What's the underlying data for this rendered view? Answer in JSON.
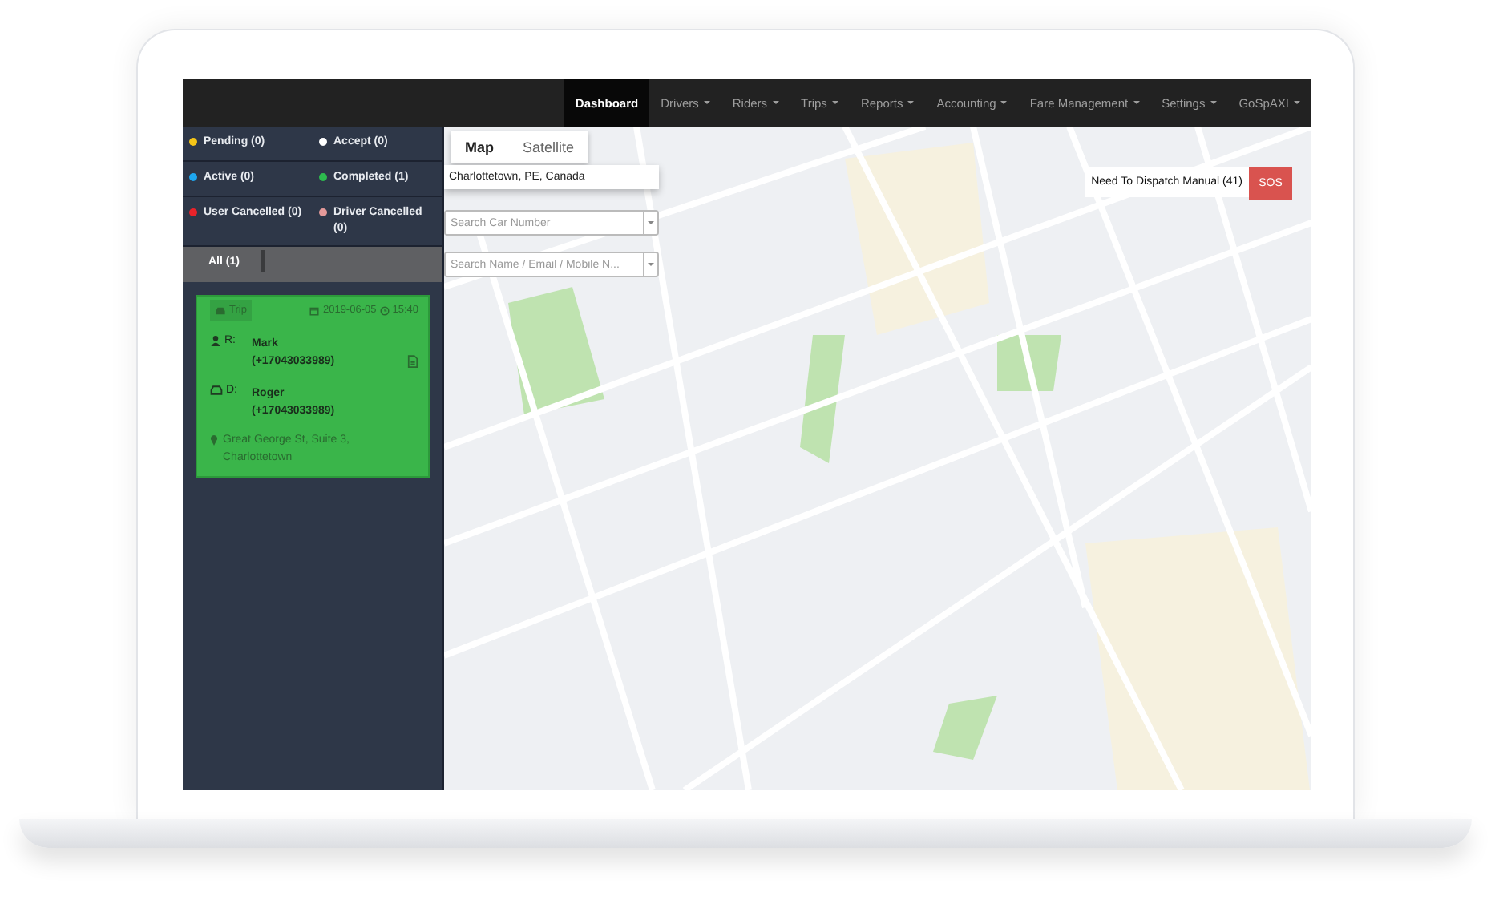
{
  "nav": {
    "items": [
      {
        "label": "Dashboard",
        "selected": true,
        "dropdown": false
      },
      {
        "label": "Drivers",
        "selected": false,
        "dropdown": true
      },
      {
        "label": "Riders",
        "selected": false,
        "dropdown": true
      },
      {
        "label": "Trips",
        "selected": false,
        "dropdown": true
      },
      {
        "label": "Reports",
        "selected": false,
        "dropdown": true
      },
      {
        "label": "Accounting",
        "selected": false,
        "dropdown": true
      },
      {
        "label": "Fare Management",
        "selected": false,
        "dropdown": true
      },
      {
        "label": "Settings",
        "selected": false,
        "dropdown": true
      },
      {
        "label": "GoSpAXI",
        "selected": false,
        "dropdown": true
      }
    ]
  },
  "sidebar": {
    "filters": [
      {
        "label": "Pending (0)",
        "color": "#f5c518"
      },
      {
        "label": "Accept (0)",
        "color": "#ffffff"
      },
      {
        "label": "Active (0)",
        "color": "#1ea7f0"
      },
      {
        "label": "Completed (1)",
        "color": "#2dbb4e"
      },
      {
        "label": "User Cancelled (0)",
        "color": "#e8232a"
      },
      {
        "label": "Driver Cancelled (0)",
        "color": "#e59a9a"
      }
    ],
    "tabs": [
      {
        "label": "All (1)",
        "selected": true
      }
    ],
    "trip": {
      "badge": "Trip",
      "date": "2019-06-05",
      "time": "15:40",
      "rider": {
        "label": "R:",
        "name": "Mark",
        "phone": "(+17043033989)"
      },
      "driver": {
        "label": "D:",
        "name": "Roger",
        "phone": "(+17043033989)"
      },
      "address": "Great George St, Suite 3, Charlottetown"
    }
  },
  "map": {
    "view_tabs": [
      {
        "label": "Map",
        "selected": true
      },
      {
        "label": "Satellite",
        "selected": false
      }
    ],
    "location": "Charlottetown, PE, Canada",
    "car_search": {
      "placeholder": "Search Car Number"
    },
    "person_search": {
      "placeholder": "Search Name / Email / Mobile N..."
    },
    "dispatch": "Need To Dispatch Manual (41)",
    "sos": "SOS"
  }
}
